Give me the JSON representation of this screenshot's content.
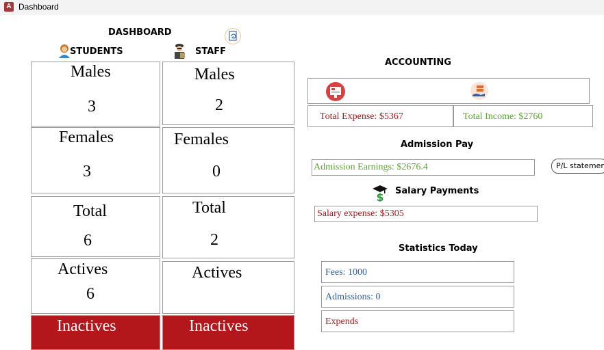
{
  "window": {
    "title": "Dashboard",
    "app_icon_letter": "A"
  },
  "dashboard": {
    "title": "DASHBOARD"
  },
  "students": {
    "heading": "STUDENTS",
    "males_label": "Males",
    "males_value": "3",
    "females_label": "Females",
    "females_value": "3",
    "total_label": "Total",
    "total_value": "6",
    "actives_label": "Actives",
    "actives_value": "6",
    "inactives_label": "Inactives"
  },
  "staff": {
    "heading": "STAFF",
    "males_label": "Males",
    "males_value": "2",
    "females_label": "Females",
    "females_value": "0",
    "total_label": "Total",
    "total_value": "2",
    "actives_label": "Actives",
    "actives_value": "",
    "inactives_label": "Inactives"
  },
  "accounting": {
    "heading": "ACCOUNTING",
    "total_expense": "Total Expense:  $5367",
    "total_income": "Total Income:  $2760"
  },
  "admission_pay": {
    "heading": "Admission Pay",
    "earnings": "Admission Earnings:  $2676.4",
    "pl_button": "P/L statement"
  },
  "salary": {
    "heading": "Salary Payments",
    "expense": "Salary expense:  $5305"
  },
  "statistics": {
    "heading": "Statistics Today",
    "fees": "Fees:  1000",
    "admissions": "Admissions:  0",
    "expends": "Expends"
  },
  "icons": {
    "refresh": "refresh-icon",
    "student": "student-icon",
    "staff": "staff-icon",
    "expense": "expense-report-icon",
    "income": "income-hand-icon",
    "salary": "salary-dollar-icon"
  },
  "colors": {
    "inactive_bg": "#b3161b",
    "expense_text": "#b3161b",
    "income_text": "#5aa532",
    "stats_text": "#2d5fa5",
    "title_icon": "#a4373a"
  }
}
